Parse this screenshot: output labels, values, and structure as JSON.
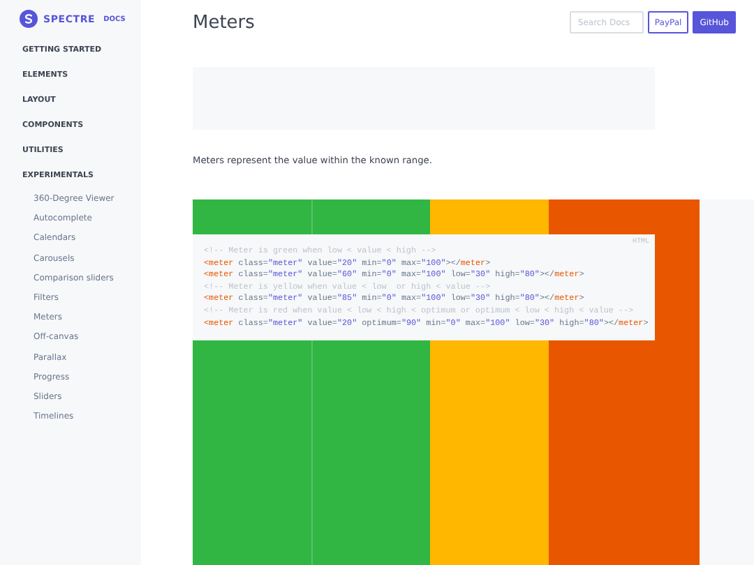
{
  "brand": {
    "name": "SPECTRE",
    "tag": "DOCS"
  },
  "sidebar": {
    "sections": [
      {
        "label": "GETTING STARTED"
      },
      {
        "label": "ELEMENTS"
      },
      {
        "label": "LAYOUT"
      },
      {
        "label": "COMPONENTS"
      },
      {
        "label": "UTILITIES"
      },
      {
        "label": "EXPERIMENTALS",
        "children": [
          {
            "label": "360-Degree Viewer"
          },
          {
            "label": "Autocomplete"
          },
          {
            "label": "Calendars"
          },
          {
            "label": "Carousels"
          },
          {
            "label": "Comparison sliders"
          },
          {
            "label": "Filters"
          },
          {
            "label": "Meters"
          },
          {
            "label": "Off-canvas"
          },
          {
            "label": "Parallax"
          },
          {
            "label": "Progress"
          },
          {
            "label": "Sliders"
          },
          {
            "label": "Timelines"
          }
        ]
      }
    ]
  },
  "header": {
    "title": "Meters",
    "search": {
      "placeholder": "Search Docs"
    },
    "buttons": [
      {
        "label": "PayPal",
        "kind": "outline"
      },
      {
        "label": "GitHub",
        "kind": "primary"
      }
    ]
  },
  "description": "Meters represent the value within the known range.",
  "meters": [
    {
      "color": "#32b643"
    },
    {
      "color": "#32b643"
    },
    {
      "color": "#ffb700"
    },
    {
      "color": "#e85600"
    }
  ],
  "code": {
    "language": "HTML",
    "lines": [
      {
        "segments": [
          {
            "kind": "comment",
            "text": "<!-- Meter is green when low < value < high -->"
          }
        ]
      },
      {
        "segments": [
          {
            "kind": "tag",
            "text": "<meter"
          },
          {
            "kind": "attr",
            "text": " class="
          },
          {
            "kind": "str",
            "text": "\"meter\""
          },
          {
            "kind": "attr",
            "text": " value="
          },
          {
            "kind": "str",
            "text": "\"20\""
          },
          {
            "kind": "attr",
            "text": " min="
          },
          {
            "kind": "str",
            "text": "\"0\""
          },
          {
            "kind": "attr",
            "text": " max="
          },
          {
            "kind": "str",
            "text": "\"100\""
          },
          {
            "kind": "attr",
            "text": "></"
          },
          {
            "kind": "tag",
            "text": "meter"
          },
          {
            "kind": "attr",
            "text": ">"
          }
        ]
      },
      {
        "segments": [
          {
            "kind": "tag",
            "text": "<meter"
          },
          {
            "kind": "attr",
            "text": " class="
          },
          {
            "kind": "str",
            "text": "\"meter\""
          },
          {
            "kind": "attr",
            "text": " value="
          },
          {
            "kind": "str",
            "text": "\"60\""
          },
          {
            "kind": "attr",
            "text": " min="
          },
          {
            "kind": "str",
            "text": "\"0\""
          },
          {
            "kind": "attr",
            "text": " max="
          },
          {
            "kind": "str",
            "text": "\"100\""
          },
          {
            "kind": "attr",
            "text": " low="
          },
          {
            "kind": "str",
            "text": "\"30\""
          },
          {
            "kind": "attr",
            "text": " high="
          },
          {
            "kind": "str",
            "text": "\"80\""
          },
          {
            "kind": "attr",
            "text": "></"
          },
          {
            "kind": "tag",
            "text": "meter"
          },
          {
            "kind": "attr",
            "text": ">"
          }
        ]
      },
      {
        "segments": [
          {
            "kind": "comment",
            "text": "<!-- Meter is yellow when value < low  or high < value -->"
          }
        ]
      },
      {
        "segments": [
          {
            "kind": "tag",
            "text": "<meter"
          },
          {
            "kind": "attr",
            "text": " class="
          },
          {
            "kind": "str",
            "text": "\"meter\""
          },
          {
            "kind": "attr",
            "text": " value="
          },
          {
            "kind": "str",
            "text": "\"85\""
          },
          {
            "kind": "attr",
            "text": " min="
          },
          {
            "kind": "str",
            "text": "\"0\""
          },
          {
            "kind": "attr",
            "text": " max="
          },
          {
            "kind": "str",
            "text": "\"100\""
          },
          {
            "kind": "attr",
            "text": " low="
          },
          {
            "kind": "str",
            "text": "\"30\""
          },
          {
            "kind": "attr",
            "text": " high="
          },
          {
            "kind": "str",
            "text": "\"80\""
          },
          {
            "kind": "attr",
            "text": "></"
          },
          {
            "kind": "tag",
            "text": "meter"
          },
          {
            "kind": "attr",
            "text": ">"
          }
        ]
      },
      {
        "segments": [
          {
            "kind": "comment",
            "text": "<!-- Meter is red when value < low < high < optimum or optimum < low < high < value -->"
          }
        ]
      },
      {
        "segments": [
          {
            "kind": "tag",
            "text": "<meter"
          },
          {
            "kind": "attr",
            "text": " class="
          },
          {
            "kind": "str",
            "text": "\"meter\""
          },
          {
            "kind": "attr",
            "text": " value="
          },
          {
            "kind": "str",
            "text": "\"20\""
          },
          {
            "kind": "attr",
            "text": " optimum="
          },
          {
            "kind": "str",
            "text": "\"90\""
          },
          {
            "kind": "attr",
            "text": " min="
          },
          {
            "kind": "str",
            "text": "\"0\""
          },
          {
            "kind": "attr",
            "text": " max="
          },
          {
            "kind": "str",
            "text": "\"100\""
          },
          {
            "kind": "attr",
            "text": " low="
          },
          {
            "kind": "str",
            "text": "\"30\""
          },
          {
            "kind": "attr",
            "text": " high="
          },
          {
            "kind": "str",
            "text": "\"80\""
          },
          {
            "kind": "attr",
            "text": "></"
          },
          {
            "kind": "tag",
            "text": "meter"
          },
          {
            "kind": "attr",
            "text": ">"
          }
        ]
      }
    ]
  }
}
